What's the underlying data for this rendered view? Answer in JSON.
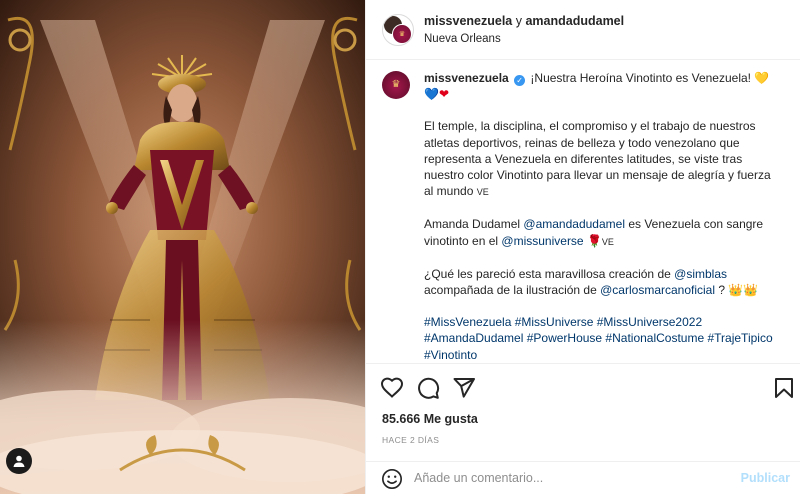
{
  "header": {
    "account": "missvenezuela",
    "joiner": "y",
    "collab": "amandadudamel",
    "location": "Nueva Orleans"
  },
  "caption": {
    "account": "missvenezuela",
    "verified_mark": "✓",
    "line1": "¡Nuestra Heroína Vinotinto es Venezuela!",
    "line1_emojis": [
      "💛",
      "💙",
      "❤"
    ],
    "paragraph1": "El temple, la disciplina, el compromiso y el trabajo de nuestros atletas deportivos, reinas de belleza y todo venezolano que representa a Venezuela en diferentes latitudes, se viste tras nuestro color Vinotinto para llevar un mensaje de alegría y fuerza al mundo",
    "paragraph1_flag": "VE",
    "p2_text1": "Amanda Dudamel",
    "p2_mention1": "@amandadudamel",
    "p2_text2": "es Venezuela con sangre vinotinto en el",
    "p2_mention2": "@missuniverse",
    "p2_rose": "🌹",
    "p2_flag": "VE",
    "p3_text1": "¿Qué les pareció esta maravillosa creación de",
    "p3_mention1": "@simblas",
    "p3_text2": "acompañada de la ilustración de",
    "p3_mention2": "@carlosmarcanoficial",
    "p3_text3": "?",
    "p3_crowns": "👑👑",
    "hashtags_line1": "#MissVenezuela #MissUniverse #MissUniverse2022",
    "hashtags_line2": "#AmandaDudamel #PowerHouse #NationalCostume #TrajeTipico",
    "hashtags_line3": "#Vinotinto"
  },
  "actions": {
    "like_icon": "heart-icon",
    "comment_icon": "comment-bubble-icon",
    "share_icon": "paper-plane-icon",
    "save_icon": "bookmark-icon"
  },
  "likes": "85.666 Me gusta",
  "time": "HACE 2 DÍAS",
  "comment": {
    "placeholder": "Añade un comentario...",
    "value": "",
    "publish_label": "Publicar"
  },
  "colors": {
    "link": "#00376b",
    "publish_disabled": "#b2dffc",
    "brand_avatar": "#8a1440",
    "verified": "#3897f0"
  }
}
